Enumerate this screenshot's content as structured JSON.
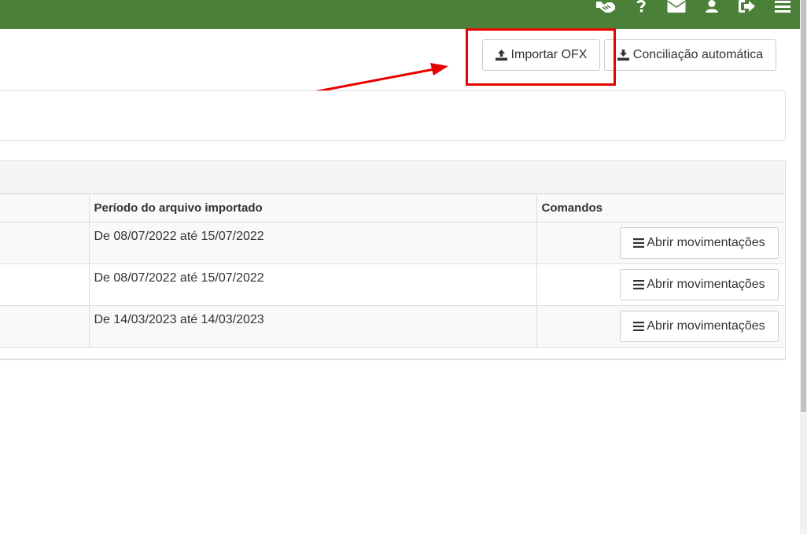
{
  "header": {
    "icons": [
      "handshake-icon",
      "question-icon",
      "envelope-icon",
      "user-icon",
      "sign-out-icon",
      "menu-icon"
    ],
    "color": "#4a8038"
  },
  "toolbar": {
    "import_label": "Importar OFX",
    "reconcile_label": "Conciliação automática"
  },
  "table": {
    "columns": [
      "",
      "Período do arquivo importado",
      "Comandos"
    ],
    "rows": [
      {
        "period": "De 08/07/2022 até 15/07/2022",
        "action": "Abrir movimentações"
      },
      {
        "period": "De 08/07/2022 até 15/07/2022",
        "action": "Abrir movimentações"
      },
      {
        "period": "De 14/03/2023 até 14/03/2023",
        "action": "Abrir movimentações"
      }
    ]
  },
  "annotation": {
    "color": "#e60000"
  }
}
